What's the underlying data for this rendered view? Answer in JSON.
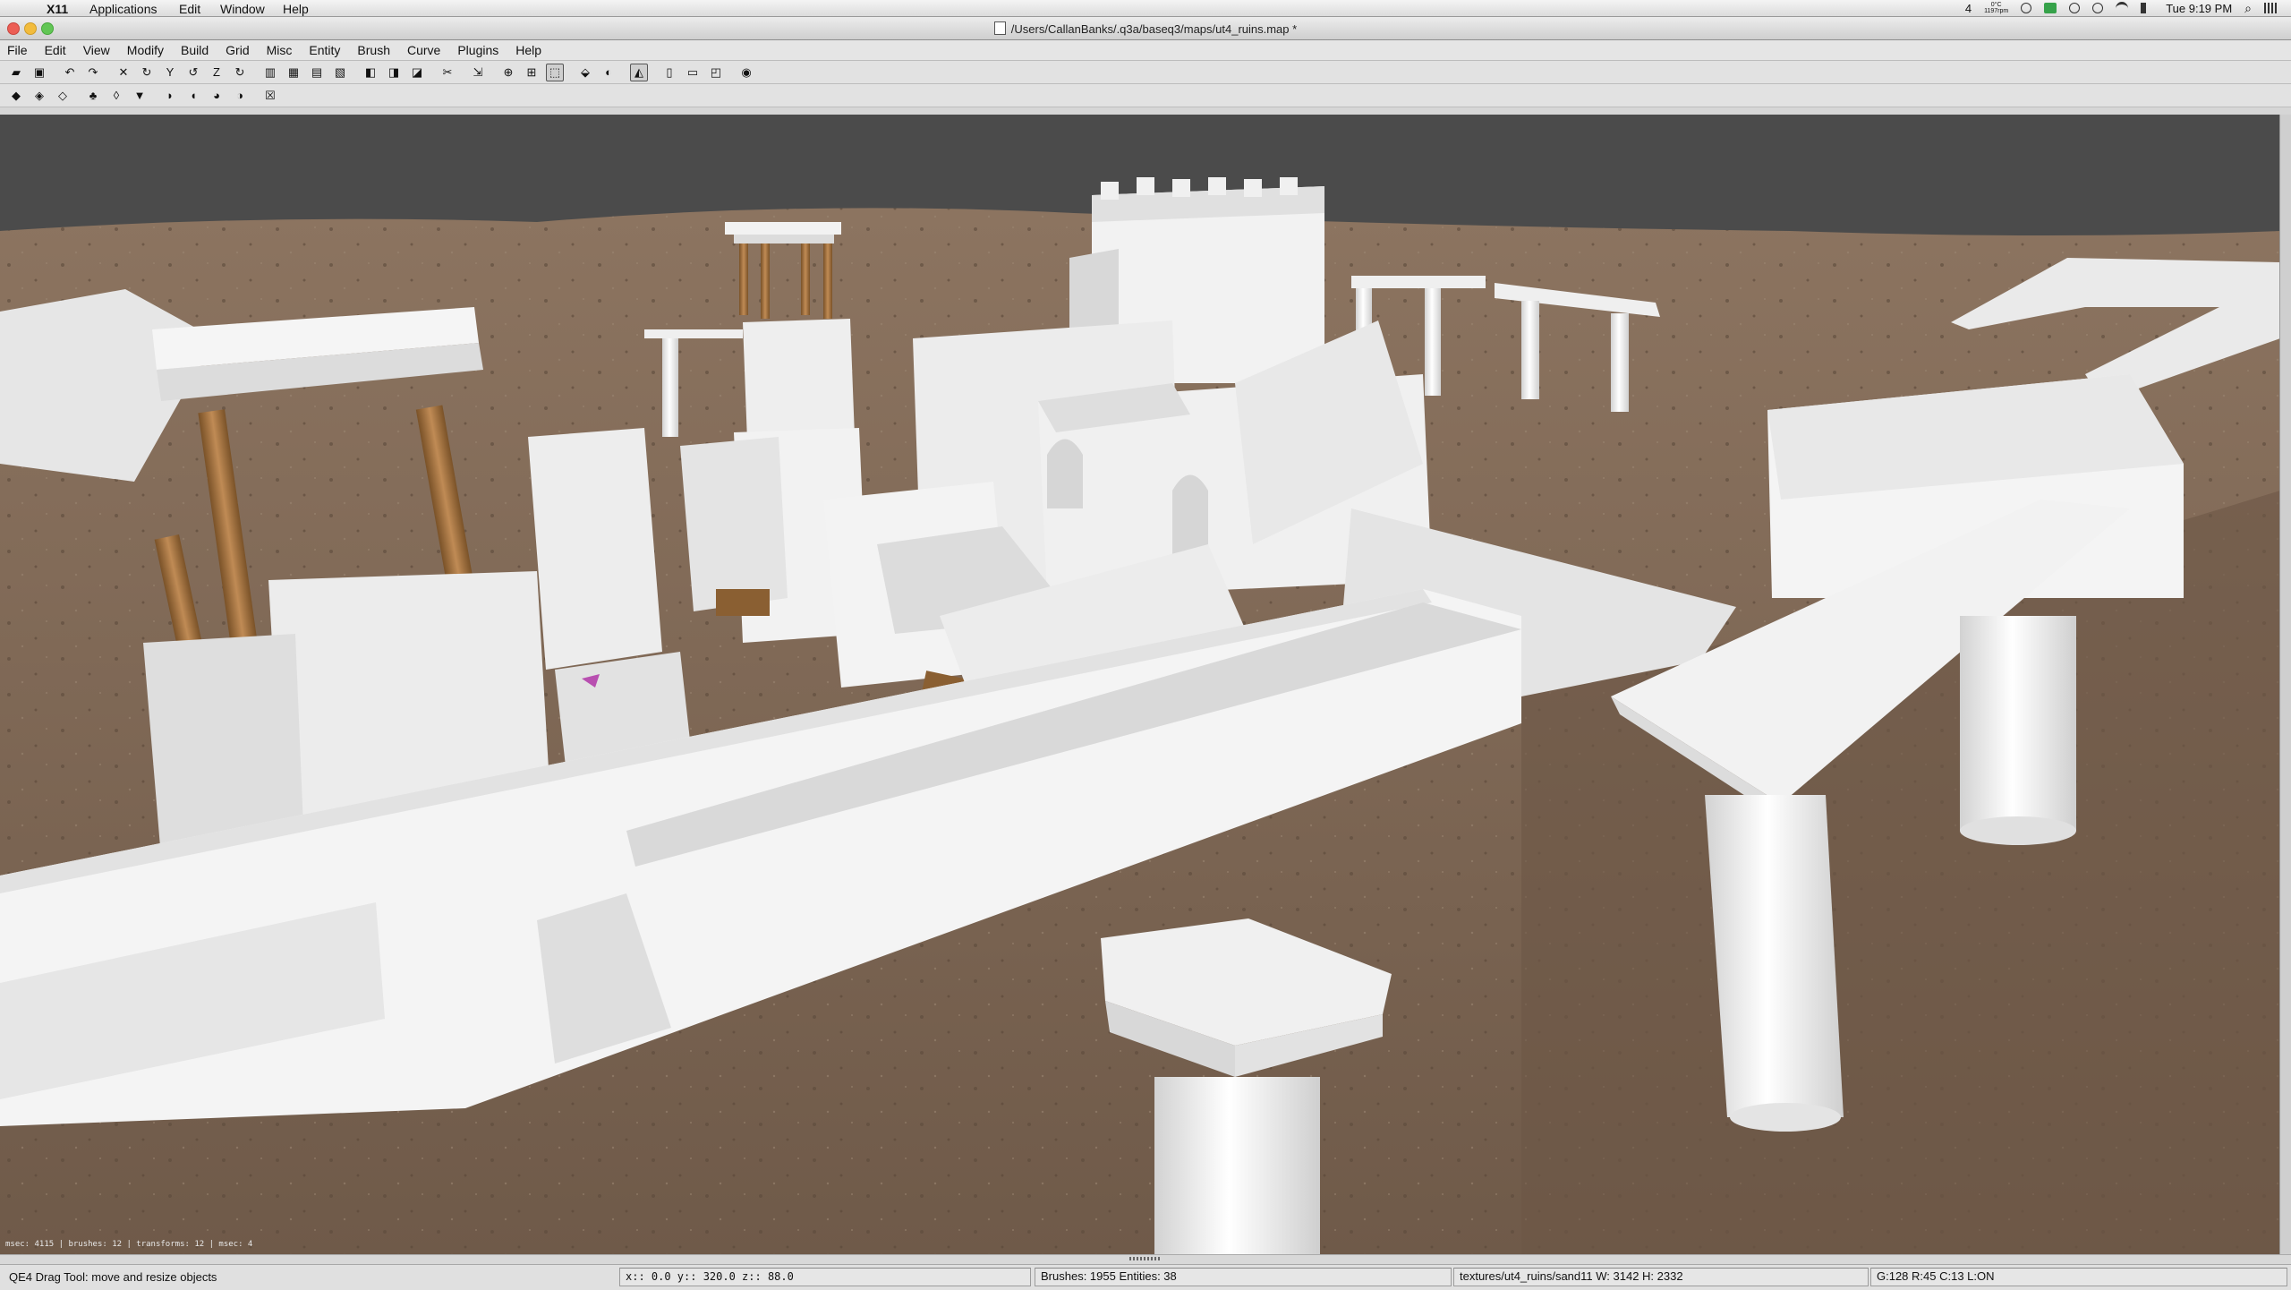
{
  "macos_menubar": {
    "app_name": "X11",
    "items": [
      "Applications",
      "Edit",
      "Window",
      "Help"
    ],
    "status": {
      "indicator": "4",
      "temp": "0°C",
      "rpm": "1197rpm",
      "clock": "Tue 9:19 PM"
    }
  },
  "window": {
    "title": "/Users/CallanBanks/.q3a/baseq3/maps/ut4_ruins.map *"
  },
  "menu": [
    "File",
    "Edit",
    "View",
    "Modify",
    "Build",
    "Grid",
    "Misc",
    "Entity",
    "Brush",
    "Curve",
    "Plugins",
    "Help"
  ],
  "toolbar1": [
    {
      "icon": "open-folder-icon",
      "glyph": "▰"
    },
    {
      "icon": "save-icon",
      "glyph": "▣"
    },
    {
      "icon": "undo-icon",
      "glyph": "↶"
    },
    {
      "icon": "redo-icon",
      "glyph": "↷"
    },
    {
      "icon": "flip-x-icon",
      "glyph": "✕"
    },
    {
      "icon": "rotate-x-icon",
      "glyph": "↻"
    },
    {
      "icon": "flip-y-icon",
      "glyph": "Y"
    },
    {
      "icon": "rotate-y-icon",
      "glyph": "↺"
    },
    {
      "icon": "flip-z-icon",
      "glyph": "Z"
    },
    {
      "icon": "rotate-z-icon",
      "glyph": "↻"
    },
    {
      "icon": "select-complete-tall-icon",
      "glyph": "▥"
    },
    {
      "icon": "select-touching-icon",
      "glyph": "▦"
    },
    {
      "icon": "select-partial-tall-icon",
      "glyph": "▤"
    },
    {
      "icon": "select-inside-icon",
      "glyph": "▧"
    },
    {
      "icon": "csg-subtract-icon",
      "glyph": "◧"
    },
    {
      "icon": "csg-merge-icon",
      "glyph": "◨"
    },
    {
      "icon": "csg-hollow-icon",
      "glyph": "◪"
    },
    {
      "icon": "clipper-icon",
      "glyph": "✂"
    },
    {
      "icon": "change-views-icon",
      "glyph": "⇲"
    },
    {
      "icon": "texture-view-icon",
      "glyph": "⊕"
    },
    {
      "icon": "cubic-clip-icon",
      "glyph": "⊞"
    },
    {
      "icon": "camera-move-icon",
      "glyph": "⬚"
    },
    {
      "icon": "camera-rotate-icon",
      "glyph": "⬙"
    },
    {
      "icon": "entity-view-icon",
      "glyph": "◐"
    },
    {
      "icon": "drag-tool-icon",
      "glyph": "◭"
    },
    {
      "icon": "scale-tool-icon",
      "glyph": "▯"
    },
    {
      "icon": "patch-inspector-icon",
      "glyph": "▭"
    },
    {
      "icon": "patch-bend-icon",
      "glyph": "◰"
    },
    {
      "icon": "patch-refresh-icon",
      "glyph": "◉"
    }
  ],
  "toolbar2": [
    {
      "icon": "plugin-bobtoolz-icon",
      "glyph": "◆"
    },
    {
      "icon": "plugin-brush-icon",
      "glyph": "◈"
    },
    {
      "icon": "plugin-prtview-icon",
      "glyph": "◇"
    },
    {
      "icon": "plugin-tree-icon",
      "glyph": "♣"
    },
    {
      "icon": "plugin-ufo-icon",
      "glyph": "◊"
    },
    {
      "icon": "plugin-down-arrow-icon",
      "glyph": "▼"
    },
    {
      "icon": "plugin-cat-icon",
      "glyph": "◗"
    },
    {
      "icon": "plugin-cat2-icon",
      "glyph": "◖"
    },
    {
      "icon": "plugin-cat3-icon",
      "glyph": "◕"
    },
    {
      "icon": "plugin-bracket-icon",
      "glyph": "◑"
    },
    {
      "icon": "plugin-close-icon",
      "glyph": "☒"
    }
  ],
  "viewport": {
    "stats": "msec: 4115 | brushes: 12 | transforms: 12 | msec: 4"
  },
  "statusbar": {
    "tool": "QE4 Drag Tool: move and resize objects",
    "xyz": "x::    0.0   y::  320.0   z::    88.0",
    "brushes": "Brushes: 1955 Entities: 38",
    "texture": "textures/ut4_ruins/sand11 W: 3142 H: 2332",
    "grid": "G:128  R:45  C:13  L:ON"
  },
  "colors": {
    "sky": "#4b4b4b",
    "ground": "#7a6450",
    "stone": "#ebebeb",
    "wood": "#a0713f"
  }
}
